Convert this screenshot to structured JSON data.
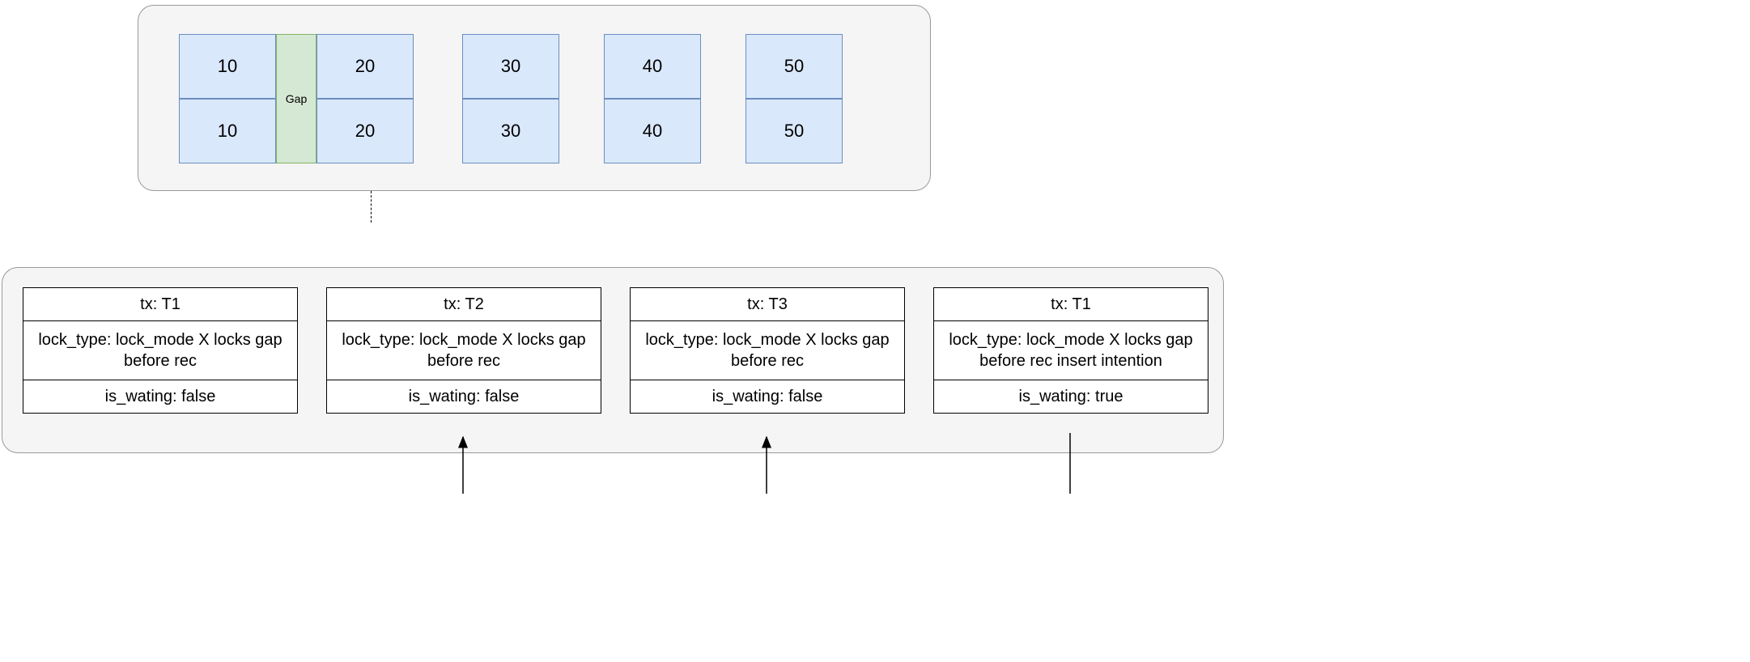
{
  "top": {
    "gap_label": "Gap",
    "columns": [
      {
        "top": "10",
        "bottom": "10"
      },
      {
        "top": "20",
        "bottom": "20"
      },
      {
        "top": "30",
        "bottom": "30"
      },
      {
        "top": "40",
        "bottom": "40"
      },
      {
        "top": "50",
        "bottom": "50"
      }
    ]
  },
  "locks": [
    {
      "tx": "tx: T1",
      "lock_type": "lock_type: lock_mode X locks gap before rec",
      "is_waiting": "is_wating: false"
    },
    {
      "tx": "tx: T2",
      "lock_type": "lock_type:  lock_mode X locks gap before rec",
      "is_waiting": "is_wating: false"
    },
    {
      "tx": "tx: T3",
      "lock_type": "lock_type: lock_mode X locks gap before rec",
      "is_waiting": "is_wating: false"
    },
    {
      "tx": "tx: T1",
      "lock_type": "lock_type: lock_mode X locks gap before rec insert intention",
      "is_waiting": "is_wating: true"
    }
  ]
}
